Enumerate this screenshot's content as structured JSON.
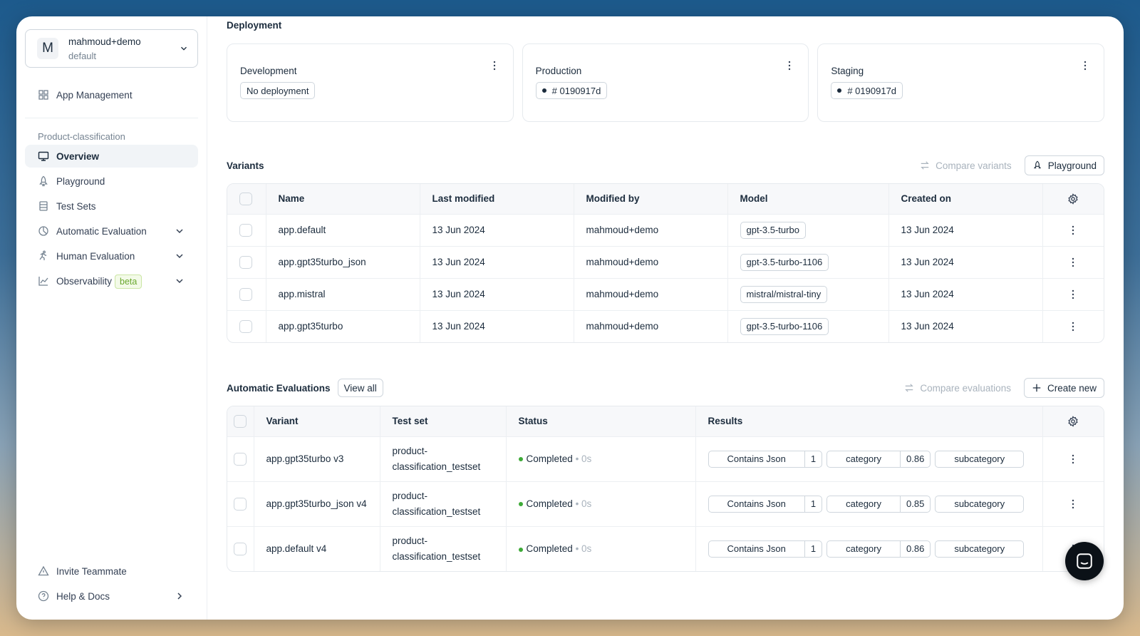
{
  "account": {
    "initial": "M",
    "name": "mahmoud+demo",
    "workspace": "default"
  },
  "sidebar": {
    "app_management": "App Management",
    "project": "Product-classification",
    "items": [
      {
        "label": "Overview",
        "icon": "monitor-icon"
      },
      {
        "label": "Playground",
        "icon": "rocket-icon"
      },
      {
        "label": "Test Sets",
        "icon": "database-icon"
      },
      {
        "label": "Automatic Evaluation",
        "icon": "chart-pie-icon"
      },
      {
        "label": "Human Evaluation",
        "icon": "person-running-icon"
      },
      {
        "label": "Observability",
        "icon": "line-chart-icon",
        "badge": "beta"
      }
    ],
    "invite": "Invite Teammate",
    "help": "Help & Docs"
  },
  "deployment": {
    "title": "Deployment",
    "cards": [
      {
        "name": "Development",
        "tag": "No deployment"
      },
      {
        "name": "Production",
        "tag": "# 0190917d"
      },
      {
        "name": "Staging",
        "tag": "# 0190917d"
      }
    ]
  },
  "variants": {
    "title": "Variants",
    "compare": "Compare variants",
    "playground": "Playground",
    "headers": [
      "Name",
      "Last modified",
      "Modified by",
      "Model",
      "Created on"
    ],
    "rows": [
      {
        "name": "app.default",
        "modified": "13 Jun 2024",
        "by": "mahmoud+demo",
        "model": "gpt-3.5-turbo",
        "created": "13 Jun 2024"
      },
      {
        "name": "app.gpt35turbo_json",
        "modified": "13 Jun 2024",
        "by": "mahmoud+demo",
        "model": "gpt-3.5-turbo-1106",
        "created": "13 Jun 2024"
      },
      {
        "name": "app.mistral",
        "modified": "13 Jun 2024",
        "by": "mahmoud+demo",
        "model": "mistral/mistral-tiny",
        "created": "13 Jun 2024"
      },
      {
        "name": "app.gpt35turbo",
        "modified": "13 Jun 2024",
        "by": "mahmoud+demo",
        "model": "gpt-3.5-turbo-1106",
        "created": "13 Jun 2024"
      }
    ]
  },
  "evaluations": {
    "title": "Automatic Evaluations",
    "view_all": "View all",
    "compare": "Compare evaluations",
    "create": "Create new",
    "headers": [
      "Variant",
      "Test set",
      "Status",
      "Results"
    ],
    "rows": [
      {
        "variant": "app.gpt35turbo v3",
        "testset": "product-classification_testset",
        "status": "Completed",
        "duration": "• 0s",
        "r1k": "Contains Json",
        "r1v": "1",
        "r2k": "category",
        "r2v": "0.86",
        "r3k": "subcategory"
      },
      {
        "variant": "app.gpt35turbo_json v4",
        "testset": "product-classification_testset",
        "status": "Completed",
        "duration": "• 0s",
        "r1k": "Contains Json",
        "r1v": "1",
        "r2k": "category",
        "r2v": "0.85",
        "r3k": "subcategory"
      },
      {
        "variant": "app.default v4",
        "testset": "product-classification_testset",
        "status": "Completed",
        "duration": "• 0s",
        "r1k": "Contains Json",
        "r1v": "1",
        "r2k": "category",
        "r2v": "0.86",
        "r3k": "subcategory"
      }
    ]
  },
  "colors": {
    "accent": "#1c2c3d",
    "success": "#3eaa38",
    "beta": "#6aa82f"
  }
}
